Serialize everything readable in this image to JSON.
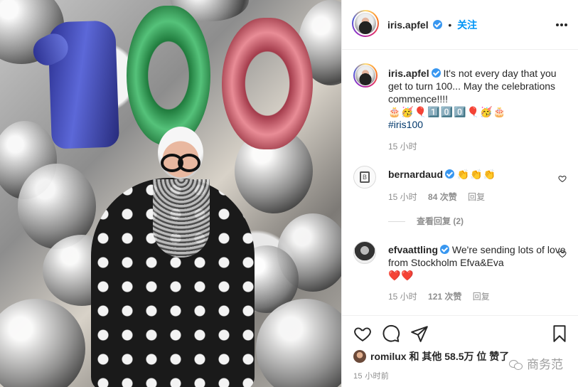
{
  "post": {
    "username": "iris.apfel",
    "follow_label": "关注",
    "separator": "•"
  },
  "caption": {
    "username": "iris.apfel",
    "text": "It's not every day that you get to turn 100... May the celebrations commence!!!!",
    "emoji_line": "🎂🥳🎈1️⃣0️⃣0️⃣🎈🥳🎂",
    "hashtag": "#iris100",
    "time": "15 小时"
  },
  "comments": [
    {
      "username": "bernardaud",
      "text": "👏👏👏",
      "time": "15 小时",
      "likes": "84 次赞",
      "reply": "回复",
      "view_replies": "查看回复 (2)"
    },
    {
      "username": "efvaattling",
      "text": "We're sending lots of love from Stockholm Efva&Eva",
      "emoji": "❤️❤️",
      "time": "15 小时",
      "likes": "121 次赞",
      "reply": "回复"
    }
  ],
  "footer": {
    "liker_name": "romilux",
    "likes_text": "和 其他 58.5万 位",
    "likes_suffix": "赞了",
    "time": "15 小时前",
    "watermark": "商务范"
  },
  "icons": {
    "like": "heart-icon",
    "comment": "comment-icon",
    "share": "paper-plane-icon",
    "save": "bookmark-icon",
    "more": "more-options-icon"
  },
  "colors": {
    "accent": "#0095f6",
    "verified": "#3897f0",
    "muted": "#8e8e8e",
    "hashtag": "#00376b"
  }
}
